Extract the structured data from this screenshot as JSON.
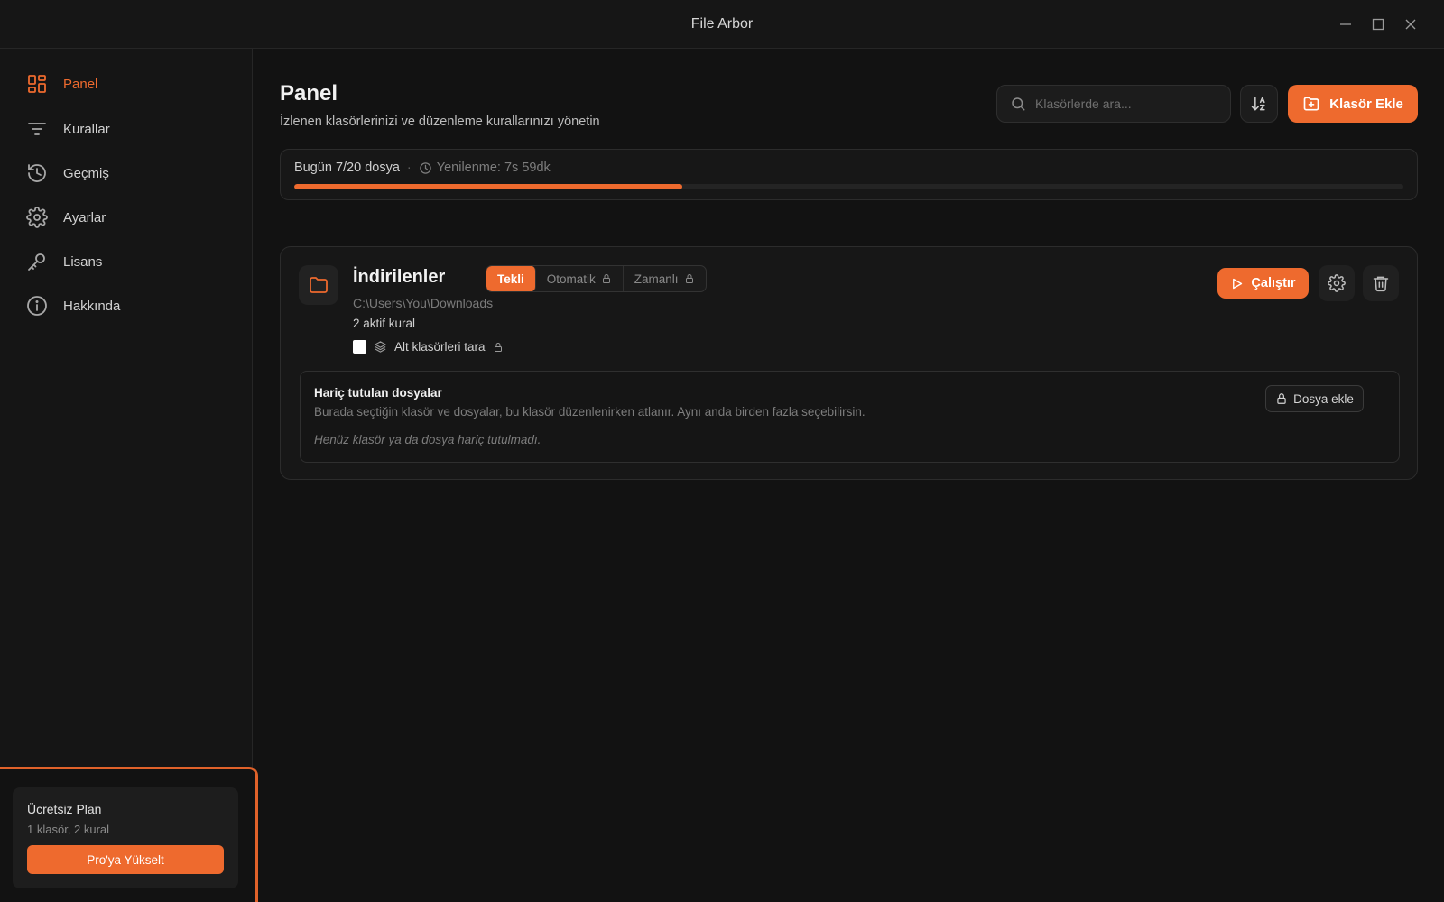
{
  "window": {
    "title": "File Arbor"
  },
  "sidebar": {
    "items": [
      {
        "label": "Panel",
        "icon": "dashboard-icon",
        "active": true
      },
      {
        "label": "Kurallar",
        "icon": "filter-icon"
      },
      {
        "label": "Geçmiş",
        "icon": "history-icon"
      },
      {
        "label": "Ayarlar",
        "icon": "gear-icon"
      },
      {
        "label": "Lisans",
        "icon": "key-icon"
      },
      {
        "label": "Hakkında",
        "icon": "info-icon"
      }
    ],
    "plan": {
      "title": "Ücretsiz Plan",
      "subtitle": "1 klasör, 2 kural",
      "upgrade_label": "Pro'ya Yükselt"
    }
  },
  "header": {
    "title": "Panel",
    "subtitle": "İzlenen klasörlerinizi ve düzenleme kurallarınızı yönetin",
    "search_placeholder": "Klasörlerde ara...",
    "add_folder_label": "Klasör Ekle"
  },
  "usage": {
    "count_text": "Bugün 7/20 dosya",
    "separator": "·",
    "renew_text": "Yenilenme: 7s 59dk",
    "used": 7,
    "limit": 20,
    "accent": "#ee6a2e"
  },
  "folder": {
    "name": "İndirilenler",
    "path": "C:\\Users\\You\\Downloads",
    "rules_text": "2 aktif kural",
    "modes": [
      {
        "label": "Tekli",
        "active": true,
        "locked": false
      },
      {
        "label": "Otomatik",
        "active": false,
        "locked": true
      },
      {
        "label": "Zamanlı",
        "active": false,
        "locked": true
      }
    ],
    "subfolders_label": "Alt klasörleri tara",
    "run_label": "Çalıştır",
    "excluded": {
      "title": "Hariç tutulan dosyalar",
      "description": "Burada seçtiğin klasör ve dosyalar, bu klasör düzenlenirken atlanır. Aynı anda birden fazla seçebilirsin.",
      "empty_text": "Henüz klasör ya da dosya hariç tutulmadı.",
      "add_label": "Dosya ekle"
    }
  }
}
